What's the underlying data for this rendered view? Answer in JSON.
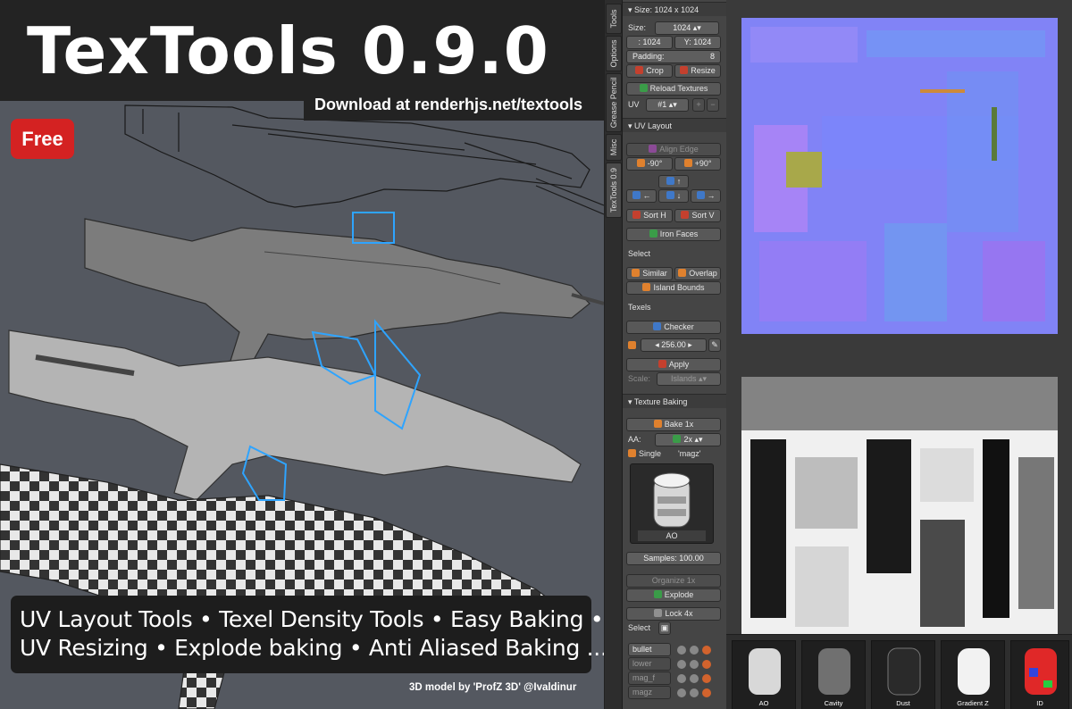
{
  "hero": {
    "title": "TexTools 0.9.0",
    "download": "Download at renderhjs.net/textools",
    "badge": "Free",
    "features_line1": "UV Layout Tools • Texel Density Tools • Easy Baking •",
    "features_line2": "UV Resizing • Explode baking • Anti Aliased Baking ...",
    "credit": "3D model by 'ProfZ 3D' @Ivaldinur"
  },
  "tabs": [
    "Tools",
    "Options",
    "Grease Pencil",
    "Misc",
    "TexTools 0.9"
  ],
  "panel": {
    "size_header": "Size: 1024 x 1024",
    "size_label": "Size:",
    "size_value": "1024",
    "x_value": ": 1024",
    "y_value": "Y: 1024",
    "padding_label": "Padding:",
    "padding_value": "8",
    "crop_label": "Crop",
    "resize_label": "Resize",
    "reload_label": "Reload Textures",
    "uv_label": "UV",
    "uv_value": "#1",
    "uv_layout_header": "UV Layout",
    "align_edge": "Align Edge",
    "rot_minus": "-90°",
    "rot_plus": "+90°",
    "arrow_up": "↑",
    "arrow_left": "←",
    "arrow_down": "↓",
    "arrow_right": "→",
    "sort_h": "Sort H",
    "sort_v": "Sort V",
    "iron_faces": "Iron Faces",
    "select_header": "Select",
    "similar": "Similar",
    "overlap": "Overlap",
    "island_bounds": "Island Bounds",
    "texels_header": "Texels",
    "checker": "Checker",
    "texel_value": "256.00",
    "apply": "Apply",
    "scale_label": "Scale:",
    "scale_value": "Islands",
    "texture_baking_header": "Texture Baking",
    "bake": "Bake 1x",
    "aa_label": "AA:",
    "aa_value": "2x",
    "single_label": "Single",
    "single_value": "'magz'",
    "ao_label": "AO",
    "samples_label": "Samples:",
    "samples_value": "100.00",
    "organize": "Organize 1x",
    "explode": "Explode",
    "lock": "Lock 4x",
    "select_label": "Select",
    "bake_sets": [
      "bullet",
      "lower",
      "mag_f",
      "magz"
    ]
  },
  "thumbnails": [
    "AO",
    "Cavity",
    "Dust",
    "Gradient Z",
    "ID"
  ],
  "colors": {
    "badge": "#d42222",
    "normal_map": "#7f80ff",
    "panel": "#454545"
  }
}
